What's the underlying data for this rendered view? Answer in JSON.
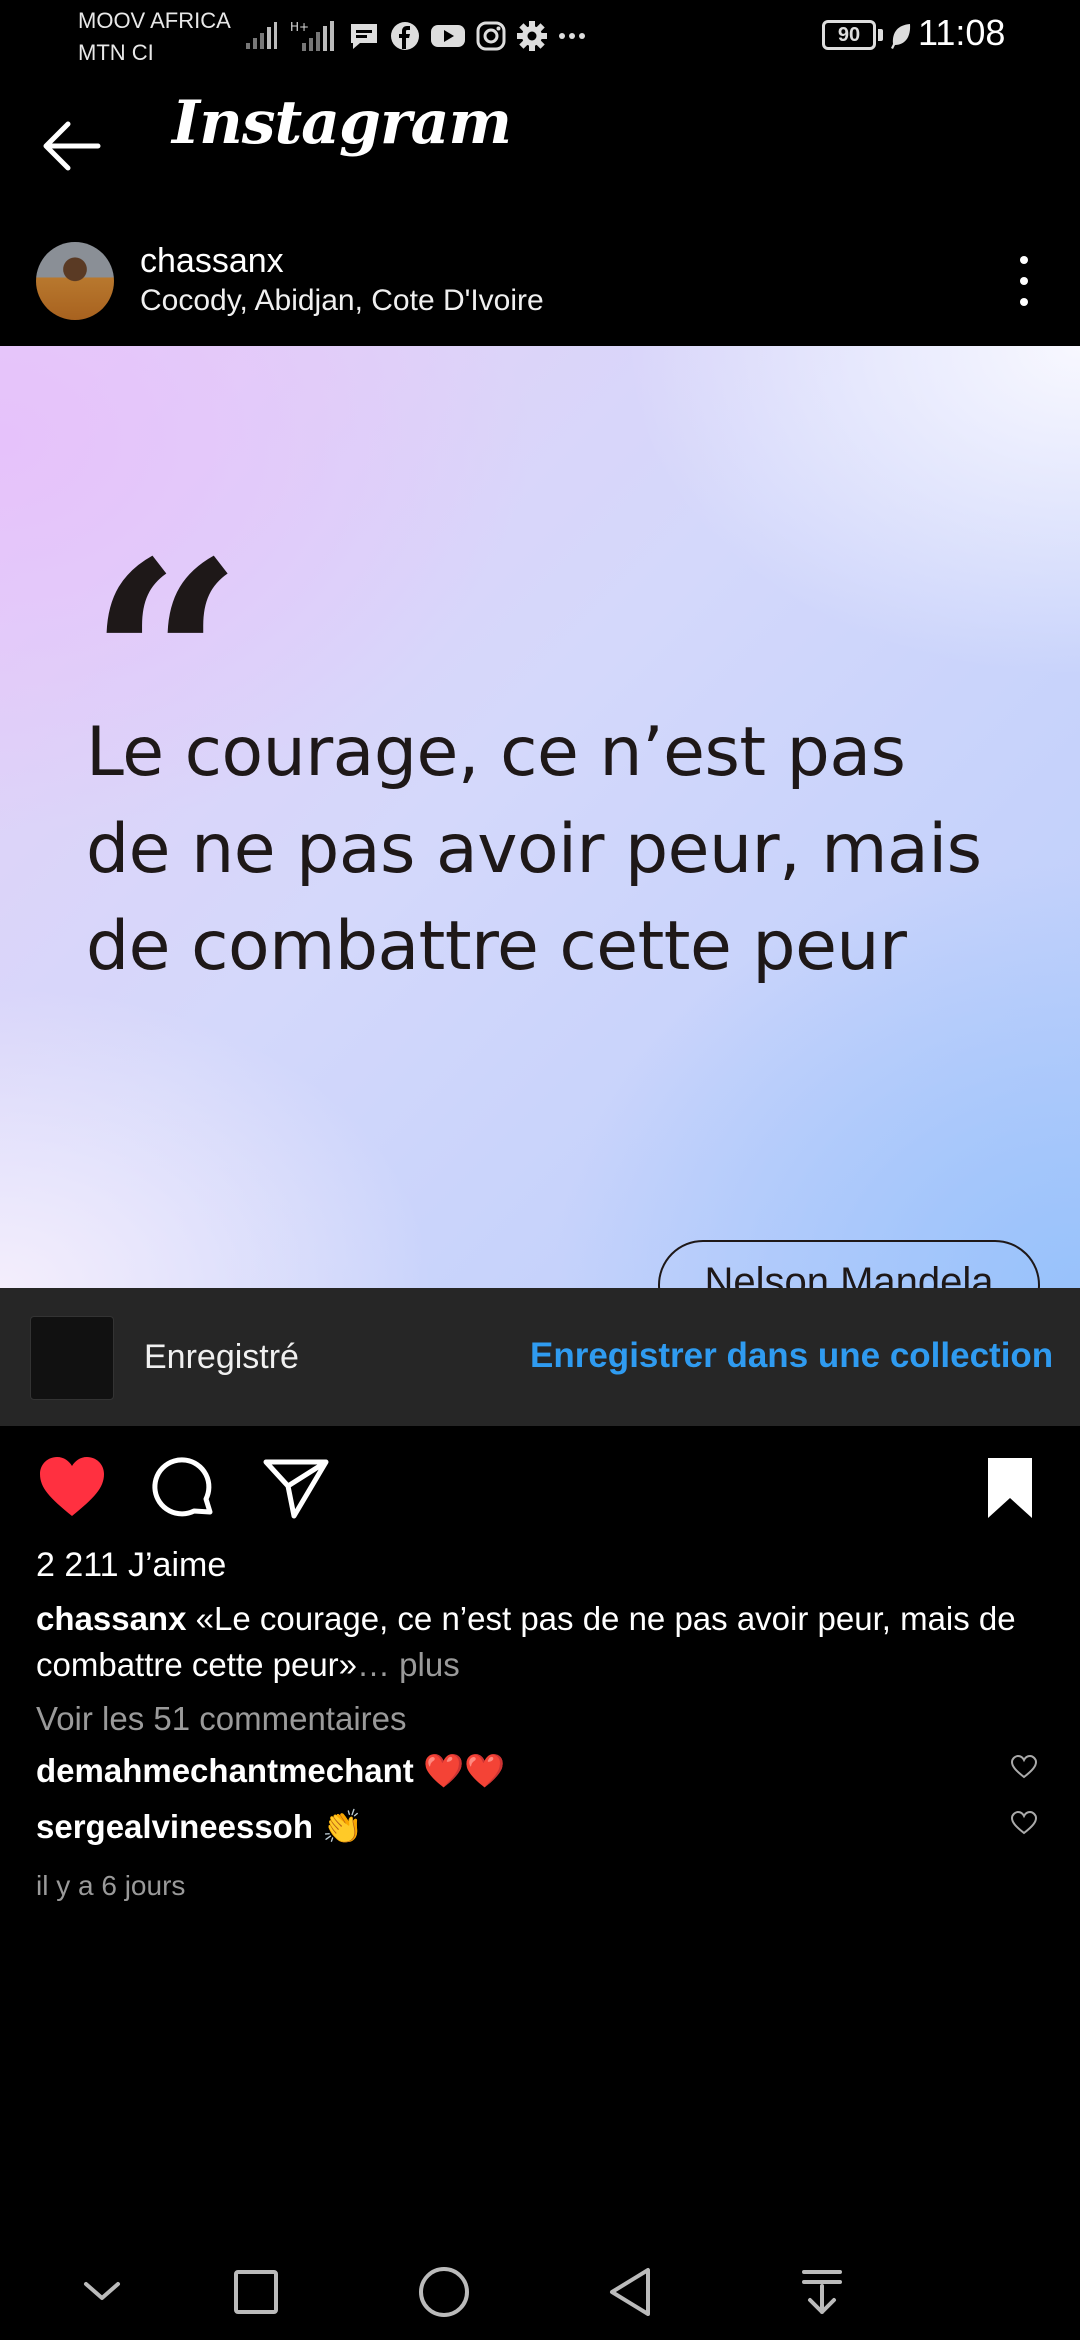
{
  "status_bar": {
    "carrier_line1": "MOOV AFRICA",
    "carrier_line2": "MTN CI",
    "icons": [
      "signal-icon",
      "signal-hplus-icon",
      "message-icon",
      "facebook-icon",
      "youtube-icon",
      "instagram-icon",
      "gear-icon",
      "more-dots-icon"
    ],
    "battery": "90",
    "time": "11:08"
  },
  "header": {
    "title": "Instagram"
  },
  "post": {
    "username": "chassanx",
    "location": "Cocody, Abidjan, Cote D'Ivoire",
    "image": {
      "quote_mark": "“",
      "quote_text": "Le courage, ce n’est pas de ne pas avoir peur, mais de combattre cette peur",
      "author": "Nelson Mandela"
    },
    "saved_banner": {
      "label": "Enregistré",
      "action": "Enregistrer dans une collection"
    },
    "likes": "2 211 J’aime",
    "caption": {
      "username": "chassanx",
      "text": "«Le courage, ce n’est pas de ne pas avoir peur, mais de combattre cette peur»",
      "more": "… plus"
    },
    "view_comments": "Voir les 51 commentaires",
    "comments": [
      {
        "username": "demahmechantmechant",
        "text": "❤️❤️"
      },
      {
        "username": "sergealvineessoh",
        "text": "👏"
      }
    ],
    "timestamp": "il y a 6 jours"
  },
  "colors": {
    "background": "#000000",
    "link_blue": "#2f9bf0",
    "like_red": "#ff3040",
    "muted": "#9a9a9a"
  }
}
